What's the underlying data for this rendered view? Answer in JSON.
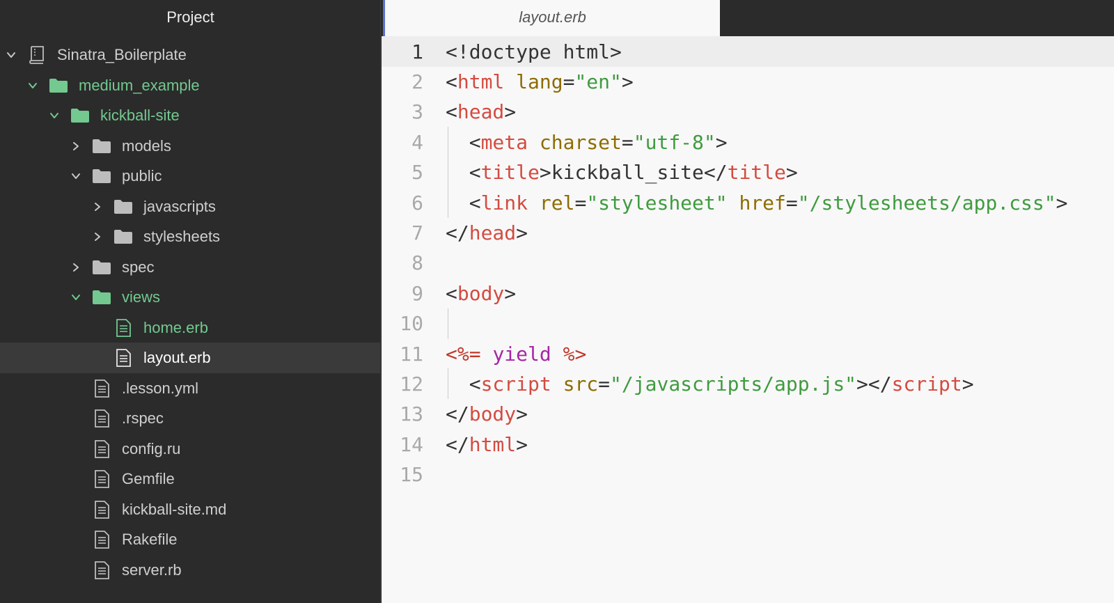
{
  "sidebar": {
    "title": "Project",
    "items": [
      {
        "label": "Sinatra_Boilerplate",
        "type": "repo",
        "chevron": "open",
        "level": 0,
        "state": "normal"
      },
      {
        "label": "medium_example",
        "type": "folder",
        "chevron": "open",
        "level": 1,
        "state": "green"
      },
      {
        "label": "kickball-site",
        "type": "folder",
        "chevron": "open",
        "level": 2,
        "state": "green"
      },
      {
        "label": "models",
        "type": "folder",
        "chevron": "closed",
        "level": 3,
        "state": "normal"
      },
      {
        "label": "public",
        "type": "folder",
        "chevron": "open",
        "level": 3,
        "state": "normal"
      },
      {
        "label": "javascripts",
        "type": "folder",
        "chevron": "closed",
        "level": 4,
        "state": "normal"
      },
      {
        "label": "stylesheets",
        "type": "folder",
        "chevron": "closed",
        "level": 4,
        "state": "normal"
      },
      {
        "label": "spec",
        "type": "folder",
        "chevron": "closed",
        "level": 3,
        "state": "normal"
      },
      {
        "label": "views",
        "type": "folder",
        "chevron": "open",
        "level": 3,
        "state": "green"
      },
      {
        "label": "home.erb",
        "type": "file",
        "chevron": "none",
        "level": 4,
        "state": "green"
      },
      {
        "label": "layout.erb",
        "type": "file",
        "chevron": "none",
        "level": 4,
        "state": "selected"
      },
      {
        "label": ".lesson.yml",
        "type": "file",
        "chevron": "none",
        "level": 3,
        "state": "normal"
      },
      {
        "label": ".rspec",
        "type": "file",
        "chevron": "none",
        "level": 3,
        "state": "normal"
      },
      {
        "label": "config.ru",
        "type": "file",
        "chevron": "none",
        "level": 3,
        "state": "normal"
      },
      {
        "label": "Gemfile",
        "type": "file",
        "chevron": "none",
        "level": 3,
        "state": "normal"
      },
      {
        "label": "kickball-site.md",
        "type": "file",
        "chevron": "none",
        "level": 3,
        "state": "normal"
      },
      {
        "label": "Rakefile",
        "type": "file",
        "chevron": "none",
        "level": 3,
        "state": "normal"
      },
      {
        "label": "server.rb",
        "type": "file",
        "chevron": "none",
        "level": 3,
        "state": "normal"
      }
    ]
  },
  "editor": {
    "tab_label": "layout.erb",
    "cursor_line": 1,
    "lines": [
      {
        "num": "1",
        "guide": false,
        "tokens": [
          [
            "p",
            "<!doctype html>"
          ]
        ]
      },
      {
        "num": "2",
        "guide": false,
        "tokens": [
          [
            "p",
            "<"
          ],
          [
            "tag",
            "html"
          ],
          [
            "p",
            " "
          ],
          [
            "attr",
            "lang"
          ],
          [
            "p",
            "="
          ],
          [
            "str",
            "\"en\""
          ],
          [
            "p",
            ">"
          ]
        ]
      },
      {
        "num": "3",
        "guide": false,
        "tokens": [
          [
            "p",
            "<"
          ],
          [
            "tag",
            "head"
          ],
          [
            "p",
            ">"
          ]
        ]
      },
      {
        "num": "4",
        "guide": true,
        "tokens": [
          [
            "p",
            "  <"
          ],
          [
            "tag",
            "meta"
          ],
          [
            "p",
            " "
          ],
          [
            "attr",
            "charset"
          ],
          [
            "p",
            "="
          ],
          [
            "str",
            "\"utf-8\""
          ],
          [
            "p",
            ">"
          ]
        ]
      },
      {
        "num": "5",
        "guide": true,
        "tokens": [
          [
            "p",
            "  <"
          ],
          [
            "tag",
            "title"
          ],
          [
            "p",
            ">kickball_site</"
          ],
          [
            "tag",
            "title"
          ],
          [
            "p",
            ">"
          ]
        ]
      },
      {
        "num": "6",
        "guide": true,
        "tokens": [
          [
            "p",
            "  <"
          ],
          [
            "tag",
            "link"
          ],
          [
            "p",
            " "
          ],
          [
            "attr",
            "rel"
          ],
          [
            "p",
            "="
          ],
          [
            "str",
            "\"stylesheet\""
          ],
          [
            "p",
            " "
          ],
          [
            "attr",
            "href"
          ],
          [
            "p",
            "="
          ],
          [
            "str",
            "\"/stylesheets/app.css\""
          ],
          [
            "p",
            ">"
          ]
        ]
      },
      {
        "num": "7",
        "guide": false,
        "tokens": [
          [
            "p",
            "</"
          ],
          [
            "tag",
            "head"
          ],
          [
            "p",
            ">"
          ]
        ]
      },
      {
        "num": "8",
        "guide": false,
        "tokens": []
      },
      {
        "num": "9",
        "guide": false,
        "tokens": [
          [
            "p",
            "<"
          ],
          [
            "tag",
            "body"
          ],
          [
            "p",
            ">"
          ]
        ]
      },
      {
        "num": "10",
        "guide": true,
        "tokens": []
      },
      {
        "num": "11",
        "guide": false,
        "tokens": [
          [
            "erb",
            "<%="
          ],
          [
            "p",
            " "
          ],
          [
            "kw",
            "yield"
          ],
          [
            "p",
            " "
          ],
          [
            "erb",
            "%>"
          ]
        ]
      },
      {
        "num": "12",
        "guide": true,
        "tokens": [
          [
            "p",
            "  <"
          ],
          [
            "tag",
            "script"
          ],
          [
            "p",
            " "
          ],
          [
            "attr",
            "src"
          ],
          [
            "p",
            "="
          ],
          [
            "str",
            "\"/javascripts/app.js\""
          ],
          [
            "p",
            "></"
          ],
          [
            "tag",
            "script"
          ],
          [
            "p",
            ">"
          ]
        ]
      },
      {
        "num": "13",
        "guide": false,
        "tokens": [
          [
            "p",
            "</"
          ],
          [
            "tag",
            "body"
          ],
          [
            "p",
            ">"
          ]
        ]
      },
      {
        "num": "14",
        "guide": false,
        "tokens": [
          [
            "p",
            "</"
          ],
          [
            "tag",
            "html"
          ],
          [
            "p",
            ">"
          ]
        ]
      },
      {
        "num": "15",
        "guide": false,
        "tokens": []
      }
    ]
  },
  "colors": {
    "sidebar_bg": "#2b2b2b",
    "editor_bg": "#f8f8f8",
    "vcs_green": "#73c990",
    "tag": "#d44b40",
    "attr": "#8e6c00",
    "string": "#3f9b3f",
    "erb": "#c0392b",
    "keyword": "#a626a4",
    "tab_accent": "#5a6fd6"
  }
}
